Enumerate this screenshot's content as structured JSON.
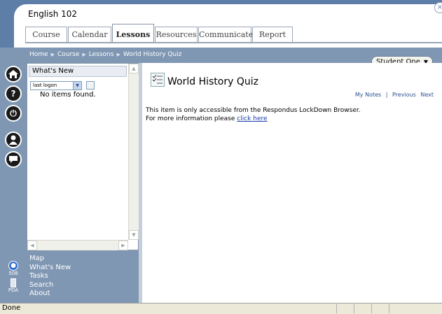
{
  "header": {
    "course_title": "English 102",
    "close_glyph": "×",
    "tabs": [
      {
        "label": "Course"
      },
      {
        "label": "Calendar"
      },
      {
        "label": "Lessons"
      },
      {
        "label": "Resources"
      },
      {
        "label": "Communicate"
      },
      {
        "label": "Report"
      }
    ],
    "active_tab": "Lessons"
  },
  "breadcrumb": [
    "Home",
    "Course",
    "Lessons",
    "World History Quiz"
  ],
  "user_menu": {
    "label": "Student One"
  },
  "rail": {
    "icons": [
      "home-icon",
      "help-icon",
      "logout-icon",
      "user-icon",
      "chat-icon"
    ],
    "accessibility": {
      "icon": "accessibility-icon",
      "label": "508"
    },
    "pda": {
      "icon": "pda-icon",
      "label": "PDA"
    }
  },
  "whats_new": {
    "title": "What's New",
    "select_value": "last logon",
    "empty_text": "No items found."
  },
  "bottom_nav": {
    "items": [
      "Map",
      "What's New",
      "Tasks",
      "Search",
      "About"
    ]
  },
  "content": {
    "title": "World History Quiz",
    "nav": {
      "notes": "My Notes",
      "previous": "Previous",
      "next": "Next"
    },
    "message_line1": "This item is only accessible from the Respondus LockDown Browser.",
    "message_line2_prefix": "For more information please",
    "link_text": "click here"
  },
  "status": {
    "text": "Done"
  },
  "colors": {
    "chrome": "#7f97b3",
    "header": "#5d7ea6",
    "link": "#1a3ba8"
  }
}
